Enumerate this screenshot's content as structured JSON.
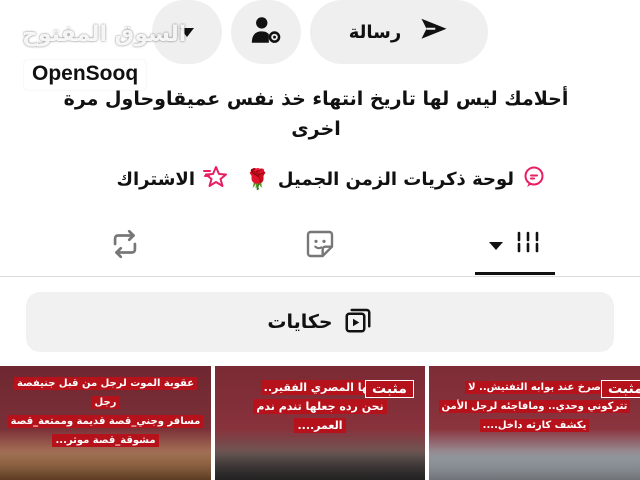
{
  "actions": {
    "message_label": "رسالة",
    "send_icon": "send-icon",
    "follow_icon": "user-settings-icon",
    "more_icon": "caret-down-icon"
  },
  "watermark": {
    "arabic": "السوق المفتوح",
    "logo": "OpenSooq"
  },
  "bio": {
    "text": "أحلامك ليس لها تاريخ انتهاء خذ نفس عميقاوحاول مرة اخرى"
  },
  "links": {
    "board_label": "لوحة ذكريات الزمن الجميل",
    "board_emoji": "🌹",
    "subscribe_label": "الاشتراك",
    "board_icon": "chat-bubble-icon",
    "subscribe_icon": "star-icon"
  },
  "tabs": [
    {
      "name": "videos",
      "icon": "grid-bars-icon",
      "active": true
    },
    {
      "name": "tagged",
      "icon": "sticker-icon",
      "active": false
    },
    {
      "name": "reposts",
      "icon": "repost-icon",
      "active": false
    }
  ],
  "stories": {
    "label": "حكايات",
    "icon": "playlist-icon"
  },
  "videos": [
    {
      "lines": [
        "عقوبة الموت لرجل من قبل جنيفصة رجل",
        "مسافر وجني_قصة قديمة وممتعة_قصة",
        "مشوقة_قصة موثر..."
      ],
      "pinned": false
    },
    {
      "lines": [
        "قها المصري الفقير..",
        "نحن رده جعلها تندم ندم",
        "العمر...."
      ],
      "pinned": true,
      "pin_label": "مثبت"
    },
    {
      "lines": [
        "صرخ عند بوابه التفتيش.. لا",
        "تتركوني وحدي.. ومافاجئه لرجل الأمن",
        "يكشف كارثه داخل...."
      ],
      "pinned": true,
      "pin_label": "مثبت"
    }
  ],
  "colors": {
    "pill_bg": "#efefef",
    "pin_red": "#b5121b",
    "icon_pink": "#e91e63"
  }
}
